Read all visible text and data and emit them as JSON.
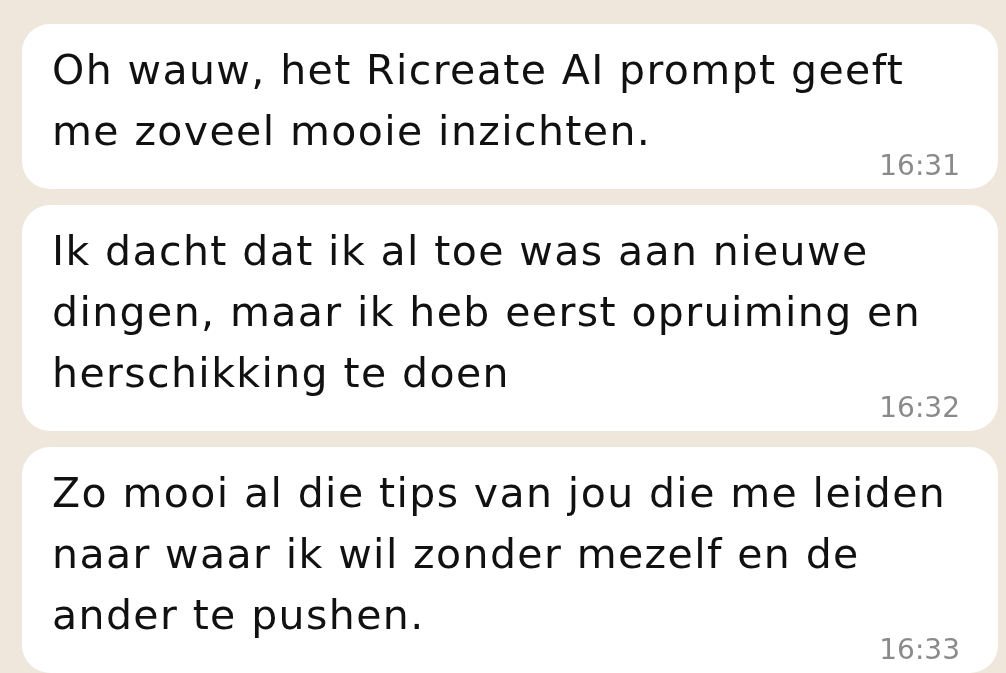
{
  "messages": [
    {
      "text": "Oh wauw, het Ricreate AI prompt geeft me zoveel mooie inzichten.",
      "time": "16:31"
    },
    {
      "text": "Ik dacht dat ik al toe was aan nieuwe dingen, maar ik heb eerst opruiming en herschikking te doen",
      "time": "16:32"
    },
    {
      "text": "Zo mooi al die tips van jou die me leiden naar waar ik wil zonder mezelf en de ander te pushen.",
      "time": "16:33"
    }
  ]
}
